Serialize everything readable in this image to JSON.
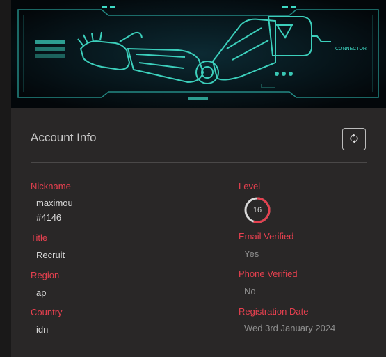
{
  "header": {
    "title": "Account Info",
    "banner_label": "CONNECTOR",
    "refresh_icon": "refresh-icon"
  },
  "left": {
    "nickname_label": "Nickname",
    "nickname_value": "maximou",
    "tag_value": "#4146",
    "title_label": "Title",
    "title_value": "Recruit",
    "region_label": "Region",
    "region_value": "ap",
    "country_label": "Country",
    "country_value": "idn"
  },
  "right": {
    "level_label": "Level",
    "level_value": "16",
    "level_progress": 0.55,
    "email_label": "Email Verified",
    "email_value": "Yes",
    "phone_label": "Phone Verified",
    "phone_value": "No",
    "reg_label": "Registration Date",
    "reg_value": "Wed 3rd January 2024"
  },
  "colors": {
    "accent": "#e6404f",
    "banner_glow": "#3fd9c4",
    "background": "#292727"
  }
}
